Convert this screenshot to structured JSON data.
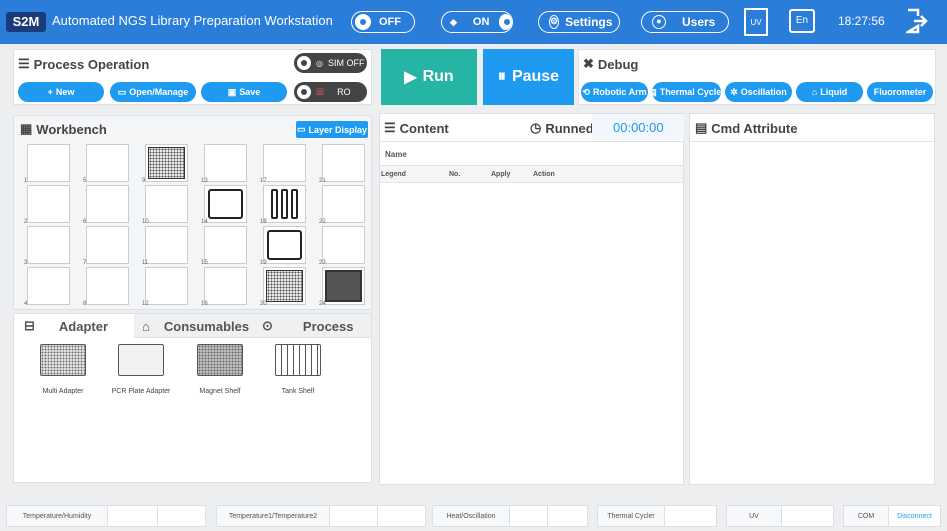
{
  "titlebar": {
    "logo": "S2M",
    "title": "Automated NGS Library Preparation Workstation",
    "toggle_off": "OFF",
    "toggle_on": "ON",
    "settings": "Settings",
    "users": "Users",
    "uv": "UV",
    "language": "En",
    "clock": "18:27:56"
  },
  "process_operation": {
    "title": "Process Operation",
    "sim_label": "SIM OFF",
    "ro_label": "RO",
    "new": "New",
    "open_manage": "Open/Manage",
    "save": "Save"
  },
  "controls": {
    "run": "Run",
    "pause": "Pause"
  },
  "debug": {
    "title": "Debug",
    "buttons": [
      "Robotic Arm",
      "Thermal Cycler",
      "Oscillation",
      "Liquid",
      "Fluorometer"
    ]
  },
  "workbench": {
    "title": "Workbench",
    "layer_display": "Layer Display",
    "slots": [
      "1",
      "2",
      "3",
      "4",
      "5",
      "6",
      "7",
      "8",
      "9",
      "10",
      "11",
      "12",
      "13",
      "14",
      "15",
      "16",
      "17",
      "18",
      "19",
      "20",
      "21",
      "22",
      "23",
      "24"
    ]
  },
  "tabs": [
    "Adapter",
    "Consumables",
    "Process"
  ],
  "adapters": [
    "Multi Adapter",
    "PCR Plate Adapter",
    "Magnet Shelf",
    "Tank Shelf"
  ],
  "content": {
    "title": "Content",
    "runned": "Runned",
    "timer": "00:00:00",
    "name_label": "Name",
    "columns": [
      "Legend",
      "No.",
      "Apply",
      "Action"
    ]
  },
  "cmd": {
    "title": "Cmd Attribute"
  },
  "status_bar": {
    "items": [
      "Temperature/Humidity",
      "Temperature1/Temperature2",
      "Heat/Oscillation",
      "Thermal Cycler",
      "UV",
      "COM"
    ],
    "com_value": "Disconnect"
  },
  "colors": {
    "primary": "#2a7ed9",
    "accent": "#1e9bf0",
    "run": "#26b5a4",
    "timer": "#1e9bf0"
  }
}
